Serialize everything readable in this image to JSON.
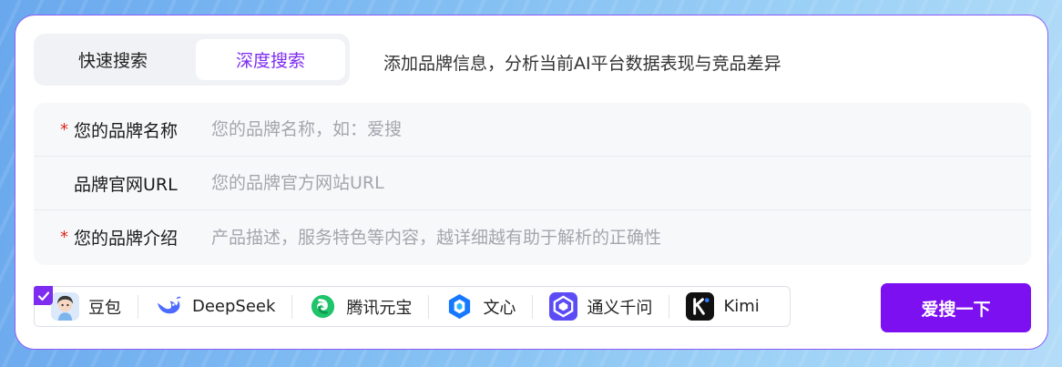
{
  "mode": {
    "tabs": [
      {
        "label": "快速搜索",
        "active": false
      },
      {
        "label": "深度搜索",
        "active": true
      }
    ],
    "description": "添加品牌信息，分析当前AI平台数据表现与竞品差异"
  },
  "form": {
    "brand_name": {
      "required_mark": "*",
      "label": "您的品牌名称",
      "value": "",
      "placeholder": "您的品牌名称，如：爱搜"
    },
    "brand_url": {
      "required_mark": "",
      "label": "品牌官网URL",
      "value": "",
      "placeholder": "您的品牌官方网站URL"
    },
    "brand_intro": {
      "required_mark": "*",
      "label": "您的品牌介绍",
      "value": "",
      "placeholder": "产品描述，服务特色等内容，越详细越有助于解析的正确性"
    }
  },
  "models": {
    "all_selected": true,
    "items": [
      {
        "name": "豆包",
        "icon": "doubao-icon"
      },
      {
        "name": "DeepSeek",
        "icon": "deepseek-icon"
      },
      {
        "name": "腾讯元宝",
        "icon": "yuanbao-icon"
      },
      {
        "name": "文心",
        "icon": "wenxin-icon"
      },
      {
        "name": "通义千问",
        "icon": "tongyi-icon"
      },
      {
        "name": "Kimi",
        "icon": "kimi-icon"
      }
    ]
  },
  "submit_label": "爱搜一下",
  "colors": {
    "accent": "#7d2cf0",
    "button": "#7d10f0",
    "border": "#8a5cf6",
    "required": "#e0251b"
  }
}
